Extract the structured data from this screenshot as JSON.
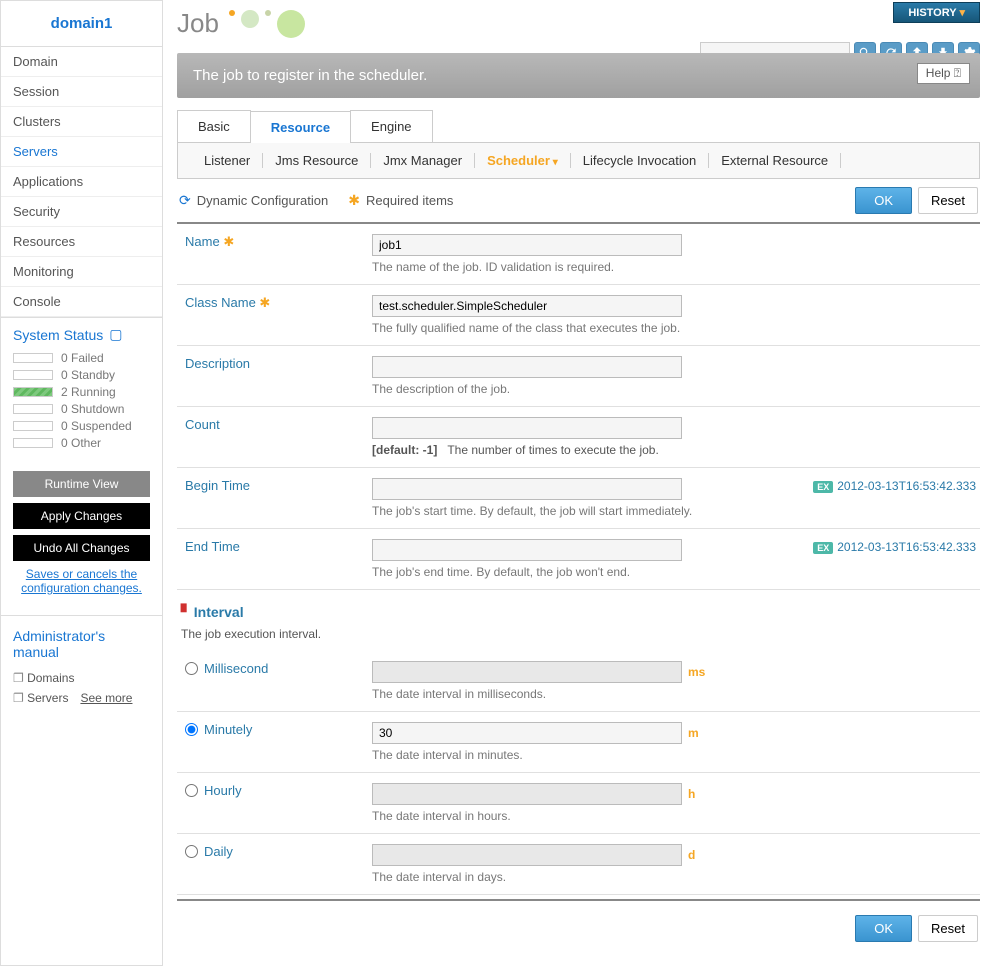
{
  "sidebar": {
    "domain": "domain1",
    "nav": [
      "Domain",
      "Session",
      "Clusters",
      "Servers",
      "Applications",
      "Security",
      "Resources",
      "Monitoring",
      "Console"
    ],
    "active_nav": "Servers",
    "status_title": "System Status",
    "status": [
      {
        "count": "0",
        "label": "Failed"
      },
      {
        "count": "0",
        "label": "Standby"
      },
      {
        "count": "2",
        "label": "Running"
      },
      {
        "count": "0",
        "label": "Shutdown"
      },
      {
        "count": "0",
        "label": "Suspended"
      },
      {
        "count": "0",
        "label": "Other"
      }
    ],
    "btn_runtime": "Runtime View",
    "btn_apply": "Apply Changes",
    "btn_undo": "Undo All Changes",
    "help_text": "Saves or cancels the configuration changes.",
    "manual_title": "Administrator's manual",
    "manual_items": [
      "Domains",
      "Servers"
    ],
    "see_more": "See more"
  },
  "header": {
    "history": "HISTORY",
    "title": "Job"
  },
  "banner": {
    "text": "The job to register in the scheduler.",
    "help": "Help ⍰"
  },
  "tabs": [
    "Basic",
    "Resource",
    "Engine"
  ],
  "active_tab": "Resource",
  "subtabs": [
    "Listener",
    "Jms Resource",
    "Jmx Manager",
    "Scheduler",
    "Lifecycle Invocation",
    "External Resource"
  ],
  "active_subtab": "Scheduler",
  "hints": {
    "dynamic": "Dynamic Configuration",
    "required": "Required items"
  },
  "buttons": {
    "ok": "OK",
    "reset": "Reset"
  },
  "fields": {
    "name": {
      "label": "Name",
      "value": "job1",
      "desc": "The name of the job. ID validation is required."
    },
    "className": {
      "label": "Class Name",
      "value": "test.scheduler.SimpleScheduler",
      "desc": "The fully qualified name of the class that executes the job."
    },
    "description": {
      "label": "Description",
      "value": "",
      "desc": "The description of the job."
    },
    "count": {
      "label": "Count",
      "value": "",
      "default": "[default: -1]",
      "desc": "The number of times to execute the job."
    },
    "beginTime": {
      "label": "Begin Time",
      "value": "",
      "desc": "The job's start time. By default, the job will start immediately.",
      "example": "2012-03-13T16:53:42.333"
    },
    "endTime": {
      "label": "End Time",
      "value": "",
      "desc": "The job's end time. By default, the job won't end.",
      "example": "2012-03-13T16:53:42.333"
    }
  },
  "interval": {
    "title": "Interval",
    "desc": "The job execution interval.",
    "options": [
      {
        "label": "Millisecond",
        "value": "",
        "unit": "ms",
        "desc": "The date interval in milliseconds.",
        "checked": false
      },
      {
        "label": "Minutely",
        "value": "30",
        "unit": "m",
        "desc": "The date interval in minutes.",
        "checked": true
      },
      {
        "label": "Hourly",
        "value": "",
        "unit": "h",
        "desc": "The date interval in hours.",
        "checked": false
      },
      {
        "label": "Daily",
        "value": "",
        "unit": "d",
        "desc": "The date interval in days.",
        "checked": false
      }
    ]
  },
  "example_tag": "EX"
}
